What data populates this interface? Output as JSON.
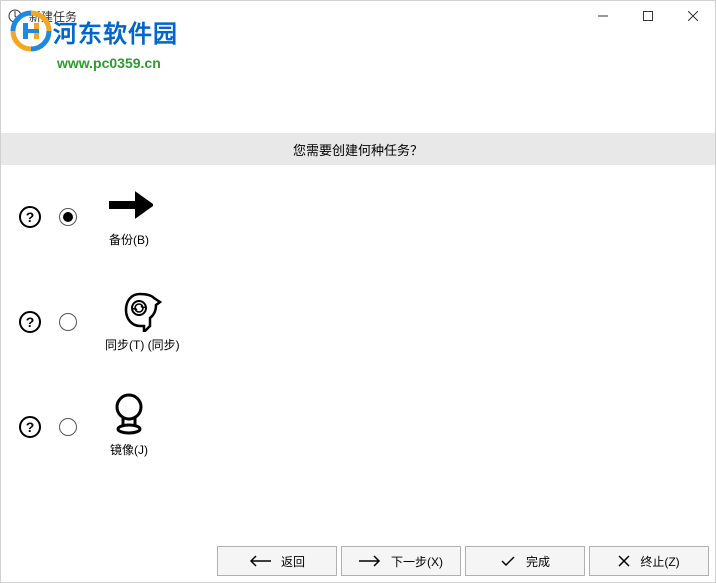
{
  "window": {
    "title": "新建任务"
  },
  "watermark": {
    "brand": "河东软件园",
    "url": "www.pc0359.cn"
  },
  "question": "您需要创建何种任务？",
  "options": {
    "backup": {
      "label": "备份(B)"
    },
    "sync": {
      "label": "同步(T) (同步)"
    },
    "mirror": {
      "label": "镜像(J)"
    }
  },
  "footer": {
    "back": "返回",
    "next": "下一步(X)",
    "finish": "完成",
    "cancel": "终止(Z)"
  }
}
